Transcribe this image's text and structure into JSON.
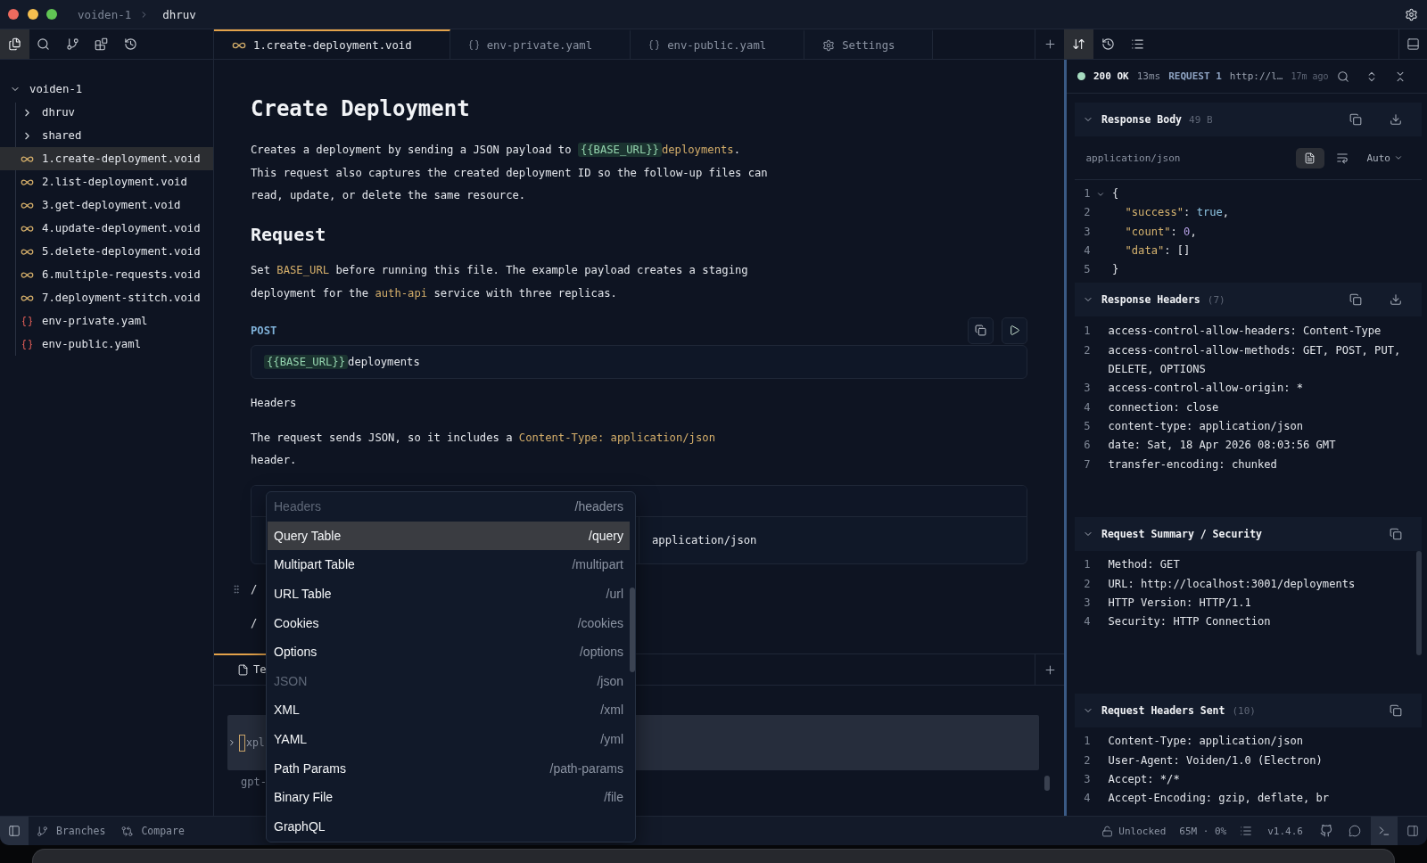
{
  "window": {
    "breadcrumb": [
      "voiden-1",
      "dhruv"
    ]
  },
  "activity_bar": [
    {
      "selected": true
    },
    {
      "selected": false
    },
    {
      "selected": false
    },
    {
      "selected": false
    },
    {
      "selected": false
    }
  ],
  "file_tree": {
    "name": "voiden-1",
    "expanded": true,
    "children": [
      {
        "name": "dhruv",
        "kind": "folder",
        "expanded": false,
        "selected": false
      },
      {
        "name": "shared",
        "kind": "folder",
        "expanded": false,
        "selected": false
      },
      {
        "name": "1.create-deployment.void",
        "kind": "void",
        "selected": true
      },
      {
        "name": "2.list-deployment.void",
        "kind": "void",
        "selected": false
      },
      {
        "name": "3.get-deployment.void",
        "kind": "void",
        "selected": false
      },
      {
        "name": "4.update-deployment.void",
        "kind": "void",
        "selected": false
      },
      {
        "name": "5.delete-deployment.void",
        "kind": "void",
        "selected": false
      },
      {
        "name": "6.multiple-requests.void",
        "kind": "void",
        "selected": false
      },
      {
        "name": "7.deployment-stitch.void",
        "kind": "void",
        "selected": false
      },
      {
        "name": "env-private.yaml",
        "kind": "yaml",
        "selected": false
      },
      {
        "name": "env-public.yaml",
        "kind": "yaml",
        "selected": false
      }
    ]
  },
  "editor_tabs": [
    {
      "label": "1.create-deployment.void",
      "kind": "void",
      "selected": true
    },
    {
      "label": "env-private.yaml",
      "kind": "yaml",
      "selected": false
    },
    {
      "label": "env-public.yaml",
      "kind": "yaml",
      "selected": false
    },
    {
      "label": "Settings",
      "kind": "settings",
      "selected": false
    }
  ],
  "document": {
    "title": "Create Deployment",
    "intro": [
      [
        {
          "text": "Creates a deployment by sending a JSON payload to ",
          "kind": "plain"
        },
        {
          "text": "{{BASE_URL}}",
          "kind": "variable"
        },
        {
          "text": "deployments",
          "kind": "code"
        },
        {
          "text": ".",
          "kind": "plain"
        }
      ],
      [
        {
          "text": "This request also captures the created deployment ID so the follow-up files can",
          "kind": "plain"
        }
      ],
      [
        {
          "text": "read, update, or delete the same resource.",
          "kind": "plain"
        }
      ]
    ],
    "section_title": "Request",
    "request_note": [
      [
        {
          "text": "Set ",
          "kind": "plain"
        },
        {
          "text": "BASE_URL",
          "kind": "code"
        },
        {
          "text": " before running this file. The example payload creates a staging",
          "kind": "plain"
        }
      ],
      [
        {
          "text": "deployment for the ",
          "kind": "plain"
        },
        {
          "text": "auth-api",
          "kind": "code"
        },
        {
          "text": " service with three replicas.",
          "kind": "plain"
        }
      ]
    ],
    "method": "POST",
    "url": [
      {
        "text": "{{BASE_URL}}",
        "kind": "variable"
      },
      {
        "text": "deployments",
        "kind": "plain"
      }
    ],
    "headers_label": "Headers",
    "headers_note": [
      [
        {
          "text": "The request sends JSON, so it includes a ",
          "kind": "plain"
        },
        {
          "text": "Content-Type: application/json",
          "kind": "code"
        }
      ],
      [
        {
          "text": "header.",
          "kind": "plain"
        }
      ]
    ],
    "headers_table": {
      "rows": [
        {
          "value": "application/json"
        }
      ]
    },
    "slash_lines": [
      {
        "text": "/",
        "hovered": true
      },
      {
        "text": "/",
        "hovered": false
      }
    ]
  },
  "bottom_panel": {
    "tabs": [
      {
        "label": "Te",
        "selected": true
      }
    ],
    "lines": [
      {
        "text": "xpl",
        "selected": true
      },
      {
        "text": "gpt-",
        "selected": false
      }
    ]
  },
  "slash_menu": {
    "items": [
      {
        "label": "Headers",
        "command": "/headers",
        "disabled": true,
        "selected": false
      },
      {
        "label": "Query Table",
        "command": "/query",
        "disabled": false,
        "selected": true
      },
      {
        "label": "Multipart Table",
        "command": "/multipart",
        "disabled": false,
        "selected": false
      },
      {
        "label": "URL Table",
        "command": "/url",
        "disabled": false,
        "selected": false
      },
      {
        "label": "Cookies",
        "command": "/cookies",
        "disabled": false,
        "selected": false
      },
      {
        "label": "Options",
        "command": "/options",
        "disabled": false,
        "selected": false
      },
      {
        "label": "JSON",
        "command": "/json",
        "disabled": true,
        "selected": false
      },
      {
        "label": "XML",
        "command": "/xml",
        "disabled": false,
        "selected": false
      },
      {
        "label": "YAML",
        "command": "/yml",
        "disabled": false,
        "selected": false
      },
      {
        "label": "Path Params",
        "command": "/path-params",
        "disabled": false,
        "selected": false
      },
      {
        "label": "Binary File",
        "command": "/file",
        "disabled": false,
        "selected": false
      },
      {
        "label": "GraphQL",
        "disabled": false,
        "selected": false
      }
    ]
  },
  "response_panel": {
    "toolbar": [
      {
        "selected": true
      },
      {
        "selected": false
      },
      {
        "selected": false
      }
    ],
    "status": {
      "code": "200 OK",
      "duration": "13ms",
      "request": "REQUEST 1",
      "url": "http://l…",
      "age": "17m ago"
    },
    "sections": [
      {
        "kind": "body",
        "title": "Response Body",
        "meta": "49 B",
        "expanded": true,
        "content_type": "application/json",
        "view": "Auto",
        "lines": [
          {
            "number": "1",
            "tokens": [
              {
                "text": "{",
                "kind": "punct"
              }
            ],
            "foldable": true
          },
          {
            "number": "2",
            "tokens": [
              {
                "text": "  \"success\"",
                "kind": "key"
              },
              {
                "text": ": ",
                "kind": "punct"
              },
              {
                "text": "true",
                "kind": "boolean"
              },
              {
                "text": ",",
                "kind": "punct"
              }
            ],
            "foldable": false
          },
          {
            "number": "3",
            "tokens": [
              {
                "text": "  \"count\"",
                "kind": "key"
              },
              {
                "text": ": ",
                "kind": "punct"
              },
              {
                "text": "0",
                "kind": "number"
              },
              {
                "text": ",",
                "kind": "punct"
              }
            ],
            "foldable": false
          },
          {
            "number": "4",
            "tokens": [
              {
                "text": "  \"data\"",
                "kind": "key"
              },
              {
                "text": ": []",
                "kind": "punct"
              }
            ],
            "foldable": false
          },
          {
            "number": "5",
            "tokens": [
              {
                "text": "}",
                "kind": "punct"
              }
            ],
            "foldable": false
          }
        ]
      },
      {
        "kind": "headers",
        "title": "Response Headers",
        "meta": "(7)",
        "expanded": true,
        "lines": [
          {
            "number": "1",
            "text": "access-control-allow-headers: Content-Type"
          },
          {
            "number": "2",
            "text": "access-control-allow-methods: GET, POST, PUT, DELETE, OPTIONS"
          },
          {
            "number": "3",
            "text": "access-control-allow-origin: *"
          },
          {
            "number": "4",
            "text": "connection: close"
          },
          {
            "number": "5",
            "text": "content-type: application/json"
          },
          {
            "number": "6",
            "text": "date: Sat, 18 Apr 2026 08:03:56 GMT"
          },
          {
            "number": "7",
            "text": "transfer-encoding: chunked"
          }
        ]
      },
      {
        "kind": "summary",
        "title": "Request Summary / Security",
        "expanded": true,
        "lines": [
          {
            "number": "1",
            "text": "Method: GET"
          },
          {
            "number": "2",
            "text": "URL: http://localhost:3001/deployments"
          },
          {
            "number": "3",
            "text": "HTTP Version: HTTP/1.1"
          },
          {
            "number": "4",
            "text": "Security: HTTP Connection"
          }
        ]
      },
      {
        "kind": "sent",
        "title": "Request Headers Sent",
        "meta": "(10)",
        "expanded": true,
        "lines": [
          {
            "number": "1",
            "text": "Content-Type: application/json"
          },
          {
            "number": "2",
            "text": "User-Agent: Voiden/1.0 (Electron)"
          },
          {
            "number": "3",
            "text": "Accept: */*"
          },
          {
            "number": "4",
            "text": "Accept-Encoding: gzip, deflate, br"
          }
        ]
      }
    ]
  },
  "status_bar": {
    "sidebar_toggle": {
      "selected": true
    },
    "items": [
      {
        "kind": "branches",
        "label": "Branches"
      },
      {
        "kind": "compare",
        "label": "Compare"
      }
    ],
    "lock": "Unlocked",
    "resources": "65M · 0%",
    "version": "v1.4.6",
    "terminal_toggle": {
      "selected": true
    }
  }
}
